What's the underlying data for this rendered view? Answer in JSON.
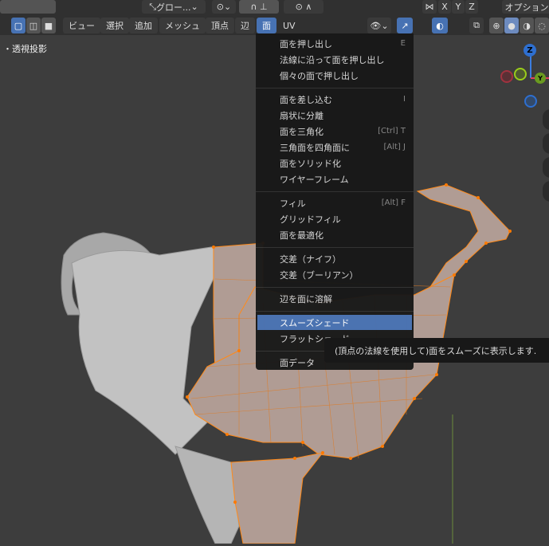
{
  "header_top": {
    "orientation": "グロー...",
    "axes": [
      "X",
      "Y",
      "Z"
    ],
    "options": "オプション"
  },
  "header_menu": {
    "items": [
      "ビュー",
      "選択",
      "追加",
      "メッシュ",
      "頂点",
      "辺",
      "面",
      "UV"
    ],
    "active": "面"
  },
  "viewport": {
    "label": "・透視投影",
    "gizmo": {
      "z": "Z",
      "y": "Y"
    }
  },
  "face_menu": {
    "groups": [
      [
        {
          "label": "面を押し出し",
          "shortcut": "E"
        },
        {
          "label": "法線に沿って面を押し出し",
          "shortcut": ""
        },
        {
          "label": "個々の面で押し出し",
          "shortcut": ""
        }
      ],
      [
        {
          "label": "面を差し込む",
          "shortcut": "I"
        },
        {
          "label": "扇状に分離",
          "shortcut": ""
        },
        {
          "label": "面を三角化",
          "shortcut": "[Ctrl] T"
        },
        {
          "label": "三角面を四角面に",
          "shortcut": "[Alt] J"
        },
        {
          "label": "面をソリッド化",
          "shortcut": ""
        },
        {
          "label": "ワイヤーフレーム",
          "shortcut": ""
        }
      ],
      [
        {
          "label": "フィル",
          "shortcut": "[Alt] F"
        },
        {
          "label": "グリッドフィル",
          "shortcut": ""
        },
        {
          "label": "面を最適化",
          "shortcut": ""
        }
      ],
      [
        {
          "label": "交差（ナイフ）",
          "shortcut": ""
        },
        {
          "label": "交差（ブーリアン）",
          "shortcut": ""
        }
      ],
      [
        {
          "label": "辺を面に溶解",
          "shortcut": ""
        }
      ],
      [
        {
          "label": "スムーズシェード",
          "shortcut": ""
        },
        {
          "label": "フラットシェード",
          "shortcut": ""
        }
      ],
      [
        {
          "label": "面データ",
          "shortcut": ""
        }
      ]
    ],
    "highlighted": "スムーズシェード"
  },
  "tooltip": "(頂点の法線を使用して)面をスムーズに表示します.",
  "colors": {
    "accent": "#4772b3",
    "selection": "#ff8000",
    "background": "#3d3d3d"
  }
}
